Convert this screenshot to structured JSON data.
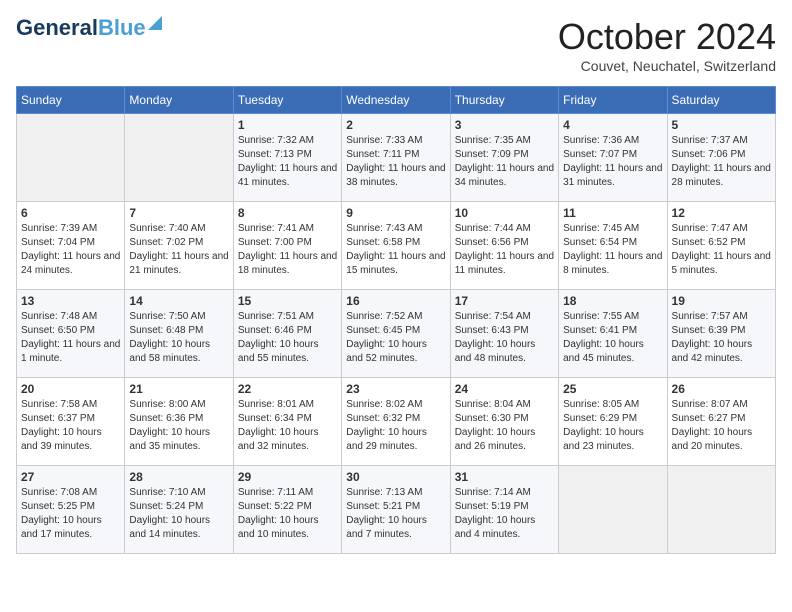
{
  "header": {
    "logo_general": "General",
    "logo_blue": "Blue",
    "month_title": "October 2024",
    "subtitle": "Couvet, Neuchatel, Switzerland"
  },
  "weekdays": [
    "Sunday",
    "Monday",
    "Tuesday",
    "Wednesday",
    "Thursday",
    "Friday",
    "Saturday"
  ],
  "weeks": [
    [
      {
        "day": "",
        "info": ""
      },
      {
        "day": "",
        "info": ""
      },
      {
        "day": "1",
        "info": "Sunrise: 7:32 AM\nSunset: 7:13 PM\nDaylight: 11 hours and 41 minutes."
      },
      {
        "day": "2",
        "info": "Sunrise: 7:33 AM\nSunset: 7:11 PM\nDaylight: 11 hours and 38 minutes."
      },
      {
        "day": "3",
        "info": "Sunrise: 7:35 AM\nSunset: 7:09 PM\nDaylight: 11 hours and 34 minutes."
      },
      {
        "day": "4",
        "info": "Sunrise: 7:36 AM\nSunset: 7:07 PM\nDaylight: 11 hours and 31 minutes."
      },
      {
        "day": "5",
        "info": "Sunrise: 7:37 AM\nSunset: 7:06 PM\nDaylight: 11 hours and 28 minutes."
      }
    ],
    [
      {
        "day": "6",
        "info": "Sunrise: 7:39 AM\nSunset: 7:04 PM\nDaylight: 11 hours and 24 minutes."
      },
      {
        "day": "7",
        "info": "Sunrise: 7:40 AM\nSunset: 7:02 PM\nDaylight: 11 hours and 21 minutes."
      },
      {
        "day": "8",
        "info": "Sunrise: 7:41 AM\nSunset: 7:00 PM\nDaylight: 11 hours and 18 minutes."
      },
      {
        "day": "9",
        "info": "Sunrise: 7:43 AM\nSunset: 6:58 PM\nDaylight: 11 hours and 15 minutes."
      },
      {
        "day": "10",
        "info": "Sunrise: 7:44 AM\nSunset: 6:56 PM\nDaylight: 11 hours and 11 minutes."
      },
      {
        "day": "11",
        "info": "Sunrise: 7:45 AM\nSunset: 6:54 PM\nDaylight: 11 hours and 8 minutes."
      },
      {
        "day": "12",
        "info": "Sunrise: 7:47 AM\nSunset: 6:52 PM\nDaylight: 11 hours and 5 minutes."
      }
    ],
    [
      {
        "day": "13",
        "info": "Sunrise: 7:48 AM\nSunset: 6:50 PM\nDaylight: 11 hours and 1 minute."
      },
      {
        "day": "14",
        "info": "Sunrise: 7:50 AM\nSunset: 6:48 PM\nDaylight: 10 hours and 58 minutes."
      },
      {
        "day": "15",
        "info": "Sunrise: 7:51 AM\nSunset: 6:46 PM\nDaylight: 10 hours and 55 minutes."
      },
      {
        "day": "16",
        "info": "Sunrise: 7:52 AM\nSunset: 6:45 PM\nDaylight: 10 hours and 52 minutes."
      },
      {
        "day": "17",
        "info": "Sunrise: 7:54 AM\nSunset: 6:43 PM\nDaylight: 10 hours and 48 minutes."
      },
      {
        "day": "18",
        "info": "Sunrise: 7:55 AM\nSunset: 6:41 PM\nDaylight: 10 hours and 45 minutes."
      },
      {
        "day": "19",
        "info": "Sunrise: 7:57 AM\nSunset: 6:39 PM\nDaylight: 10 hours and 42 minutes."
      }
    ],
    [
      {
        "day": "20",
        "info": "Sunrise: 7:58 AM\nSunset: 6:37 PM\nDaylight: 10 hours and 39 minutes."
      },
      {
        "day": "21",
        "info": "Sunrise: 8:00 AM\nSunset: 6:36 PM\nDaylight: 10 hours and 35 minutes."
      },
      {
        "day": "22",
        "info": "Sunrise: 8:01 AM\nSunset: 6:34 PM\nDaylight: 10 hours and 32 minutes."
      },
      {
        "day": "23",
        "info": "Sunrise: 8:02 AM\nSunset: 6:32 PM\nDaylight: 10 hours and 29 minutes."
      },
      {
        "day": "24",
        "info": "Sunrise: 8:04 AM\nSunset: 6:30 PM\nDaylight: 10 hours and 26 minutes."
      },
      {
        "day": "25",
        "info": "Sunrise: 8:05 AM\nSunset: 6:29 PM\nDaylight: 10 hours and 23 minutes."
      },
      {
        "day": "26",
        "info": "Sunrise: 8:07 AM\nSunset: 6:27 PM\nDaylight: 10 hours and 20 minutes."
      }
    ],
    [
      {
        "day": "27",
        "info": "Sunrise: 7:08 AM\nSunset: 5:25 PM\nDaylight: 10 hours and 17 minutes."
      },
      {
        "day": "28",
        "info": "Sunrise: 7:10 AM\nSunset: 5:24 PM\nDaylight: 10 hours and 14 minutes."
      },
      {
        "day": "29",
        "info": "Sunrise: 7:11 AM\nSunset: 5:22 PM\nDaylight: 10 hours and 10 minutes."
      },
      {
        "day": "30",
        "info": "Sunrise: 7:13 AM\nSunset: 5:21 PM\nDaylight: 10 hours and 7 minutes."
      },
      {
        "day": "31",
        "info": "Sunrise: 7:14 AM\nSunset: 5:19 PM\nDaylight: 10 hours and 4 minutes."
      },
      {
        "day": "",
        "info": ""
      },
      {
        "day": "",
        "info": ""
      }
    ]
  ]
}
